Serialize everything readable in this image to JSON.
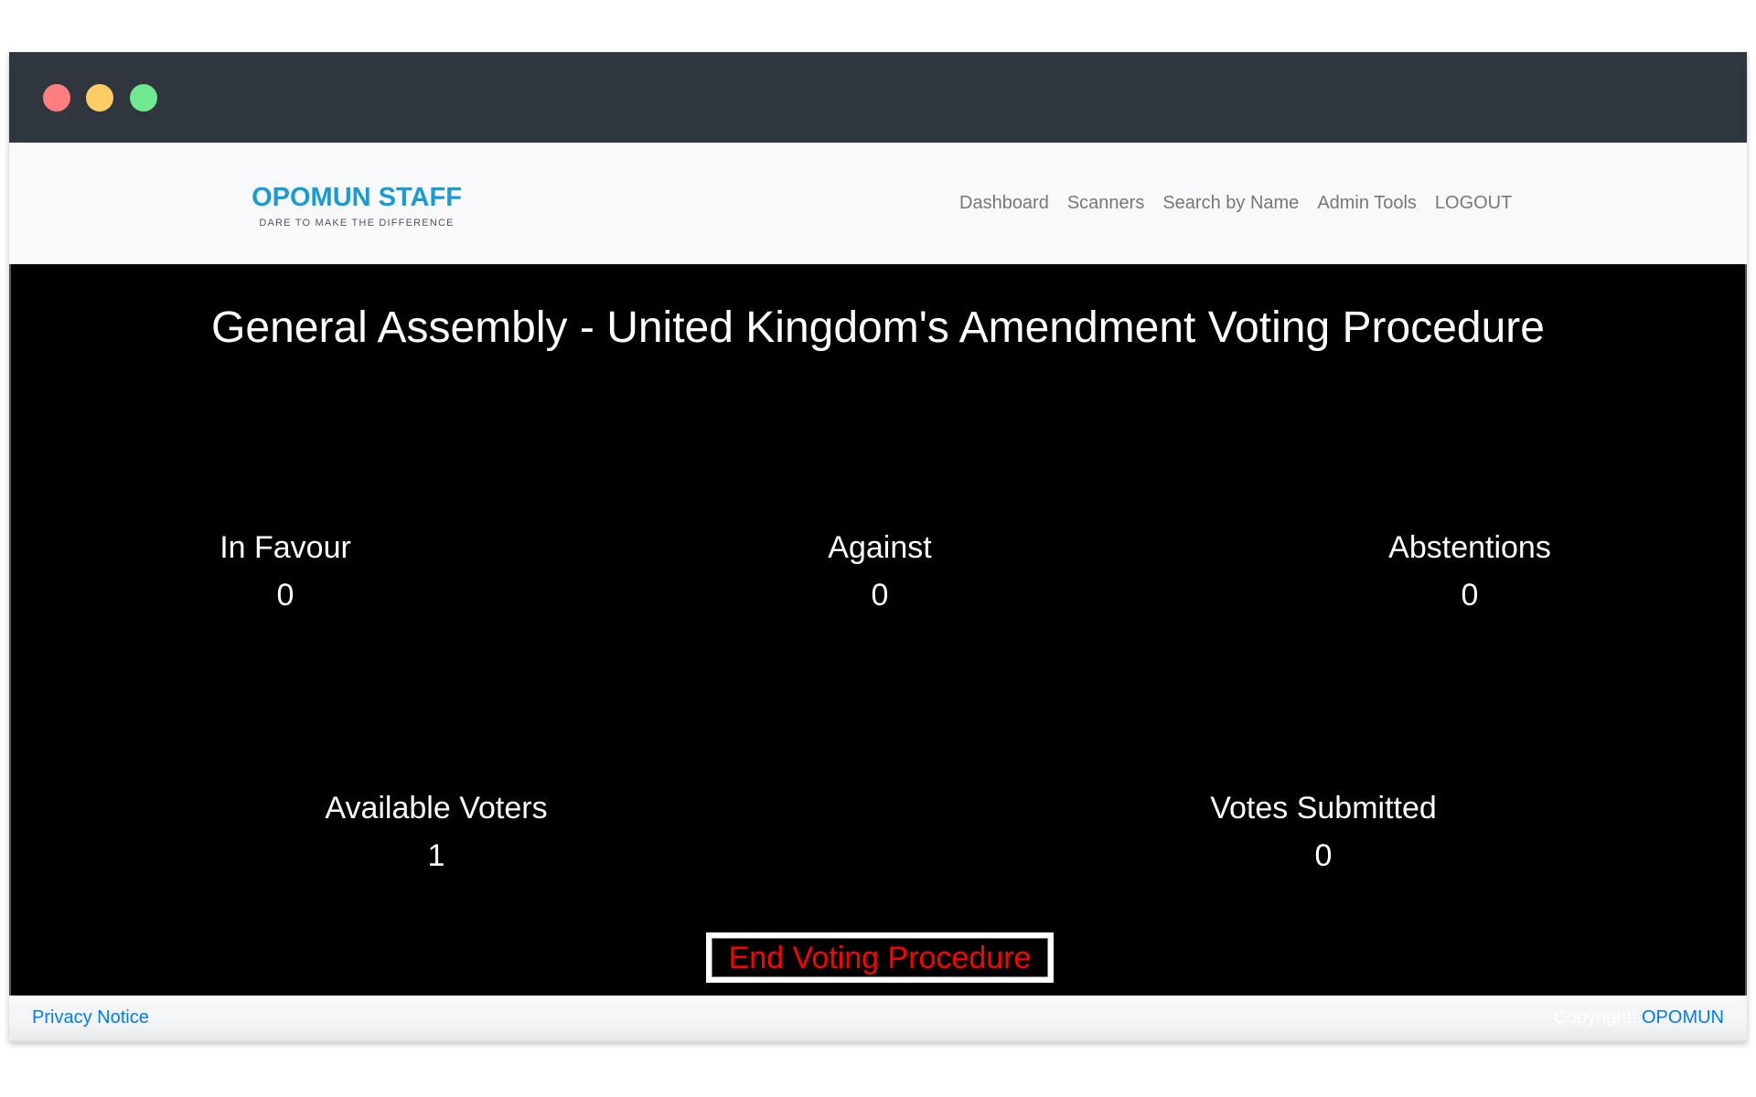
{
  "window": {
    "controls": [
      "close",
      "minimize",
      "maximize"
    ]
  },
  "navbar": {
    "brand_title": "OPOMUN STAFF",
    "brand_tagline": "DARE TO MAKE THE DIFFERENCE",
    "links": [
      {
        "label": "Dashboard"
      },
      {
        "label": "Scanners"
      },
      {
        "label": "Search by Name"
      },
      {
        "label": "Admin Tools"
      },
      {
        "label": "LOGOUT"
      }
    ]
  },
  "main": {
    "title": "General Assembly - United Kingdom's Amendment Voting Procedure",
    "stats": {
      "in_favour": {
        "label": "In Favour",
        "value": "0"
      },
      "against": {
        "label": "Against",
        "value": "0"
      },
      "abstentions": {
        "label": "Abstentions",
        "value": "0"
      },
      "available_voters": {
        "label": "Available Voters",
        "value": "1"
      },
      "votes_submitted": {
        "label": "Votes Submitted",
        "value": "0"
      }
    },
    "end_button_label": "End Voting Procedure"
  },
  "footer": {
    "privacy_label": "Privacy Notice",
    "copyright_label": "Copyright: ",
    "copyright_link": "OPOMUN"
  },
  "colors": {
    "brand": "#1a9ad6",
    "link": "#007bff",
    "end_button_text": "#ff0000",
    "main_background": "#000000"
  }
}
